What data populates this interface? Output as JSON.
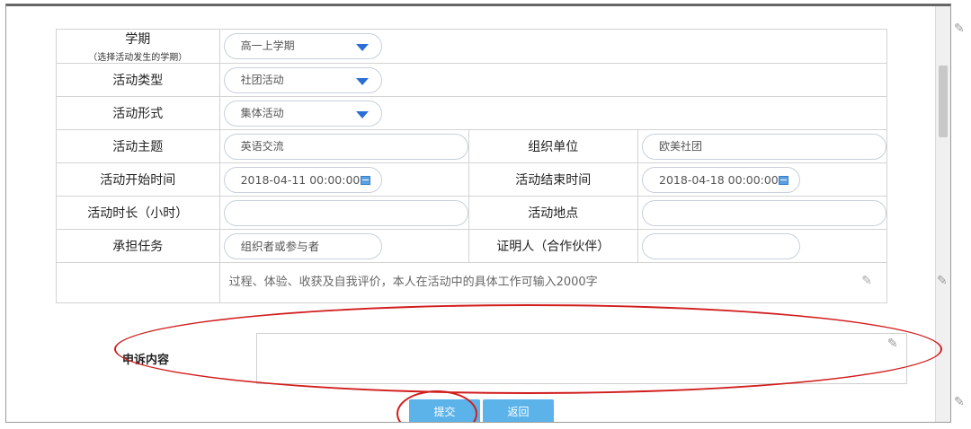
{
  "form": {
    "semester": {
      "label": "学期",
      "hint": "（选择活动发生的学期）",
      "value": "高一上学期"
    },
    "activity_type": {
      "label": "活动类型",
      "value": "社团活动"
    },
    "activity_form": {
      "label": "活动形式",
      "value": "集体活动"
    },
    "theme": {
      "label": "活动主题",
      "value": "英语交流"
    },
    "organizer": {
      "label": "组织单位",
      "value": "欧美社团"
    },
    "start_time": {
      "label": "活动开始时间",
      "value": "2018-04-11 00:00:00"
    },
    "end_time": {
      "label": "活动结束时间",
      "value": "2018-04-18 00:00:00"
    },
    "duration": {
      "label": "活动时长（小时）",
      "value": ""
    },
    "location": {
      "label": "活动地点",
      "value": ""
    },
    "role": {
      "label": "承担任务",
      "placeholder": "组织者或参与者"
    },
    "witness": {
      "label": "证明人（合作伙伴）",
      "value": ""
    },
    "description": {
      "placeholder": "过程、体验、收获及自我评价，本人在活动中的具体工作可输入2000字"
    }
  },
  "appeal": {
    "label": "申诉内容",
    "value": ""
  },
  "buttons": {
    "submit": "提交",
    "back": "返回"
  },
  "colors": {
    "button": "#5bb3ea",
    "caret": "#2b6fd6",
    "annotation": "#d21d1d"
  },
  "icons": [
    "dropdown-caret-icon",
    "calendar-icon",
    "pen-icon"
  ]
}
